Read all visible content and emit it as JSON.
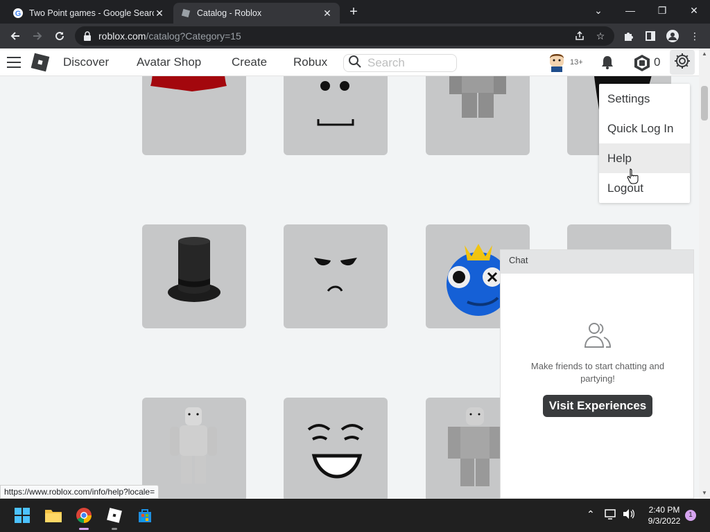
{
  "browser": {
    "tabs": [
      {
        "title": "Two Point games - Google Search",
        "active": false
      },
      {
        "title": "Catalog - Roblox",
        "active": true
      }
    ],
    "url_host": "roblox.com",
    "url_path": "/catalog?Category=15",
    "status_url": "https://www.roblox.com/info/help?locale="
  },
  "header": {
    "nav": [
      "Discover",
      "Avatar Shop",
      "Create",
      "Robux"
    ],
    "search_placeholder": "Search",
    "age_badge": "13+",
    "robux_count": "0"
  },
  "settings_menu": {
    "items": [
      "Settings",
      "Quick Log In",
      "Help",
      "Logout"
    ],
    "hovered": "Help"
  },
  "chat": {
    "title": "Chat",
    "empty_message": "Make friends to start chatting and partying!",
    "button": "Visit Experiences"
  },
  "taskbar": {
    "time": "2:40 PM",
    "date": "9/3/2022",
    "notifications": "1"
  },
  "colors": {
    "page_bg": "#f2f4f5",
    "card_bg": "#c6c7c8",
    "header_text": "#393b3d",
    "chrome_dark": "#202124"
  }
}
